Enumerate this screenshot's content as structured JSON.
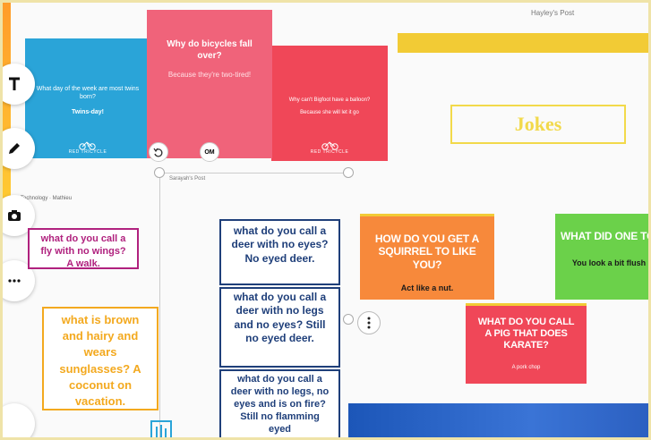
{
  "left_post": {
    "cards": [
      {
        "question": "What day of the week are most twins born?",
        "answer": "Twins-day!",
        "brand": "RED TRICYCLE"
      },
      {
        "question": "Why do bicycles fall over?",
        "answer": "Because they're two-tired!"
      },
      {
        "question": "Why can't Bigfoot have a balloon?",
        "answer": "Because she will let it go",
        "brand": "RED TRICYCLE"
      }
    ],
    "caption": "Sarayah's Post",
    "control_badge": "OM"
  },
  "middle_post": {
    "breadcrumb": "Technology · Mathieu",
    "notes": [
      {
        "text": "what do you call a fly with no wings? A walk."
      },
      {
        "text": "what is brown and hairy and wears sunglasses? A coconut on vacation."
      },
      {
        "text": "what do you call a deer with no eyes? No eyed deer."
      },
      {
        "text": "what do you call a deer with no legs and no eyes? Still no eyed deer."
      },
      {
        "text": "what do you call a deer with no legs, no eyes and is on fire? Still no flamming eyed"
      }
    ]
  },
  "right_post": {
    "title": "Hayley's Post",
    "heading": "Jokes",
    "cards": [
      {
        "question": "How do you get a squirrel to like you?",
        "answer": "Act like a nut."
      },
      {
        "question": "What did one to say to the othe",
        "answer": "You look a bit flush"
      },
      {
        "question": "What do you call a pig that does karate?",
        "answer": "A pork chop"
      }
    ]
  },
  "colors": {
    "blue": "#2aa4d8",
    "pink": "#f0637a",
    "red": "#f04758",
    "orange": "#f7893b",
    "green": "#6bd14a",
    "yellow": "#f2cb35",
    "magenta_note": "#b0217e",
    "gold_note": "#f3a91f",
    "navy_note": "#1f3f7a"
  },
  "toolbar": [
    "text-tool-icon",
    "pen-tool-icon",
    "camera-tool-icon",
    "more-icon"
  ]
}
